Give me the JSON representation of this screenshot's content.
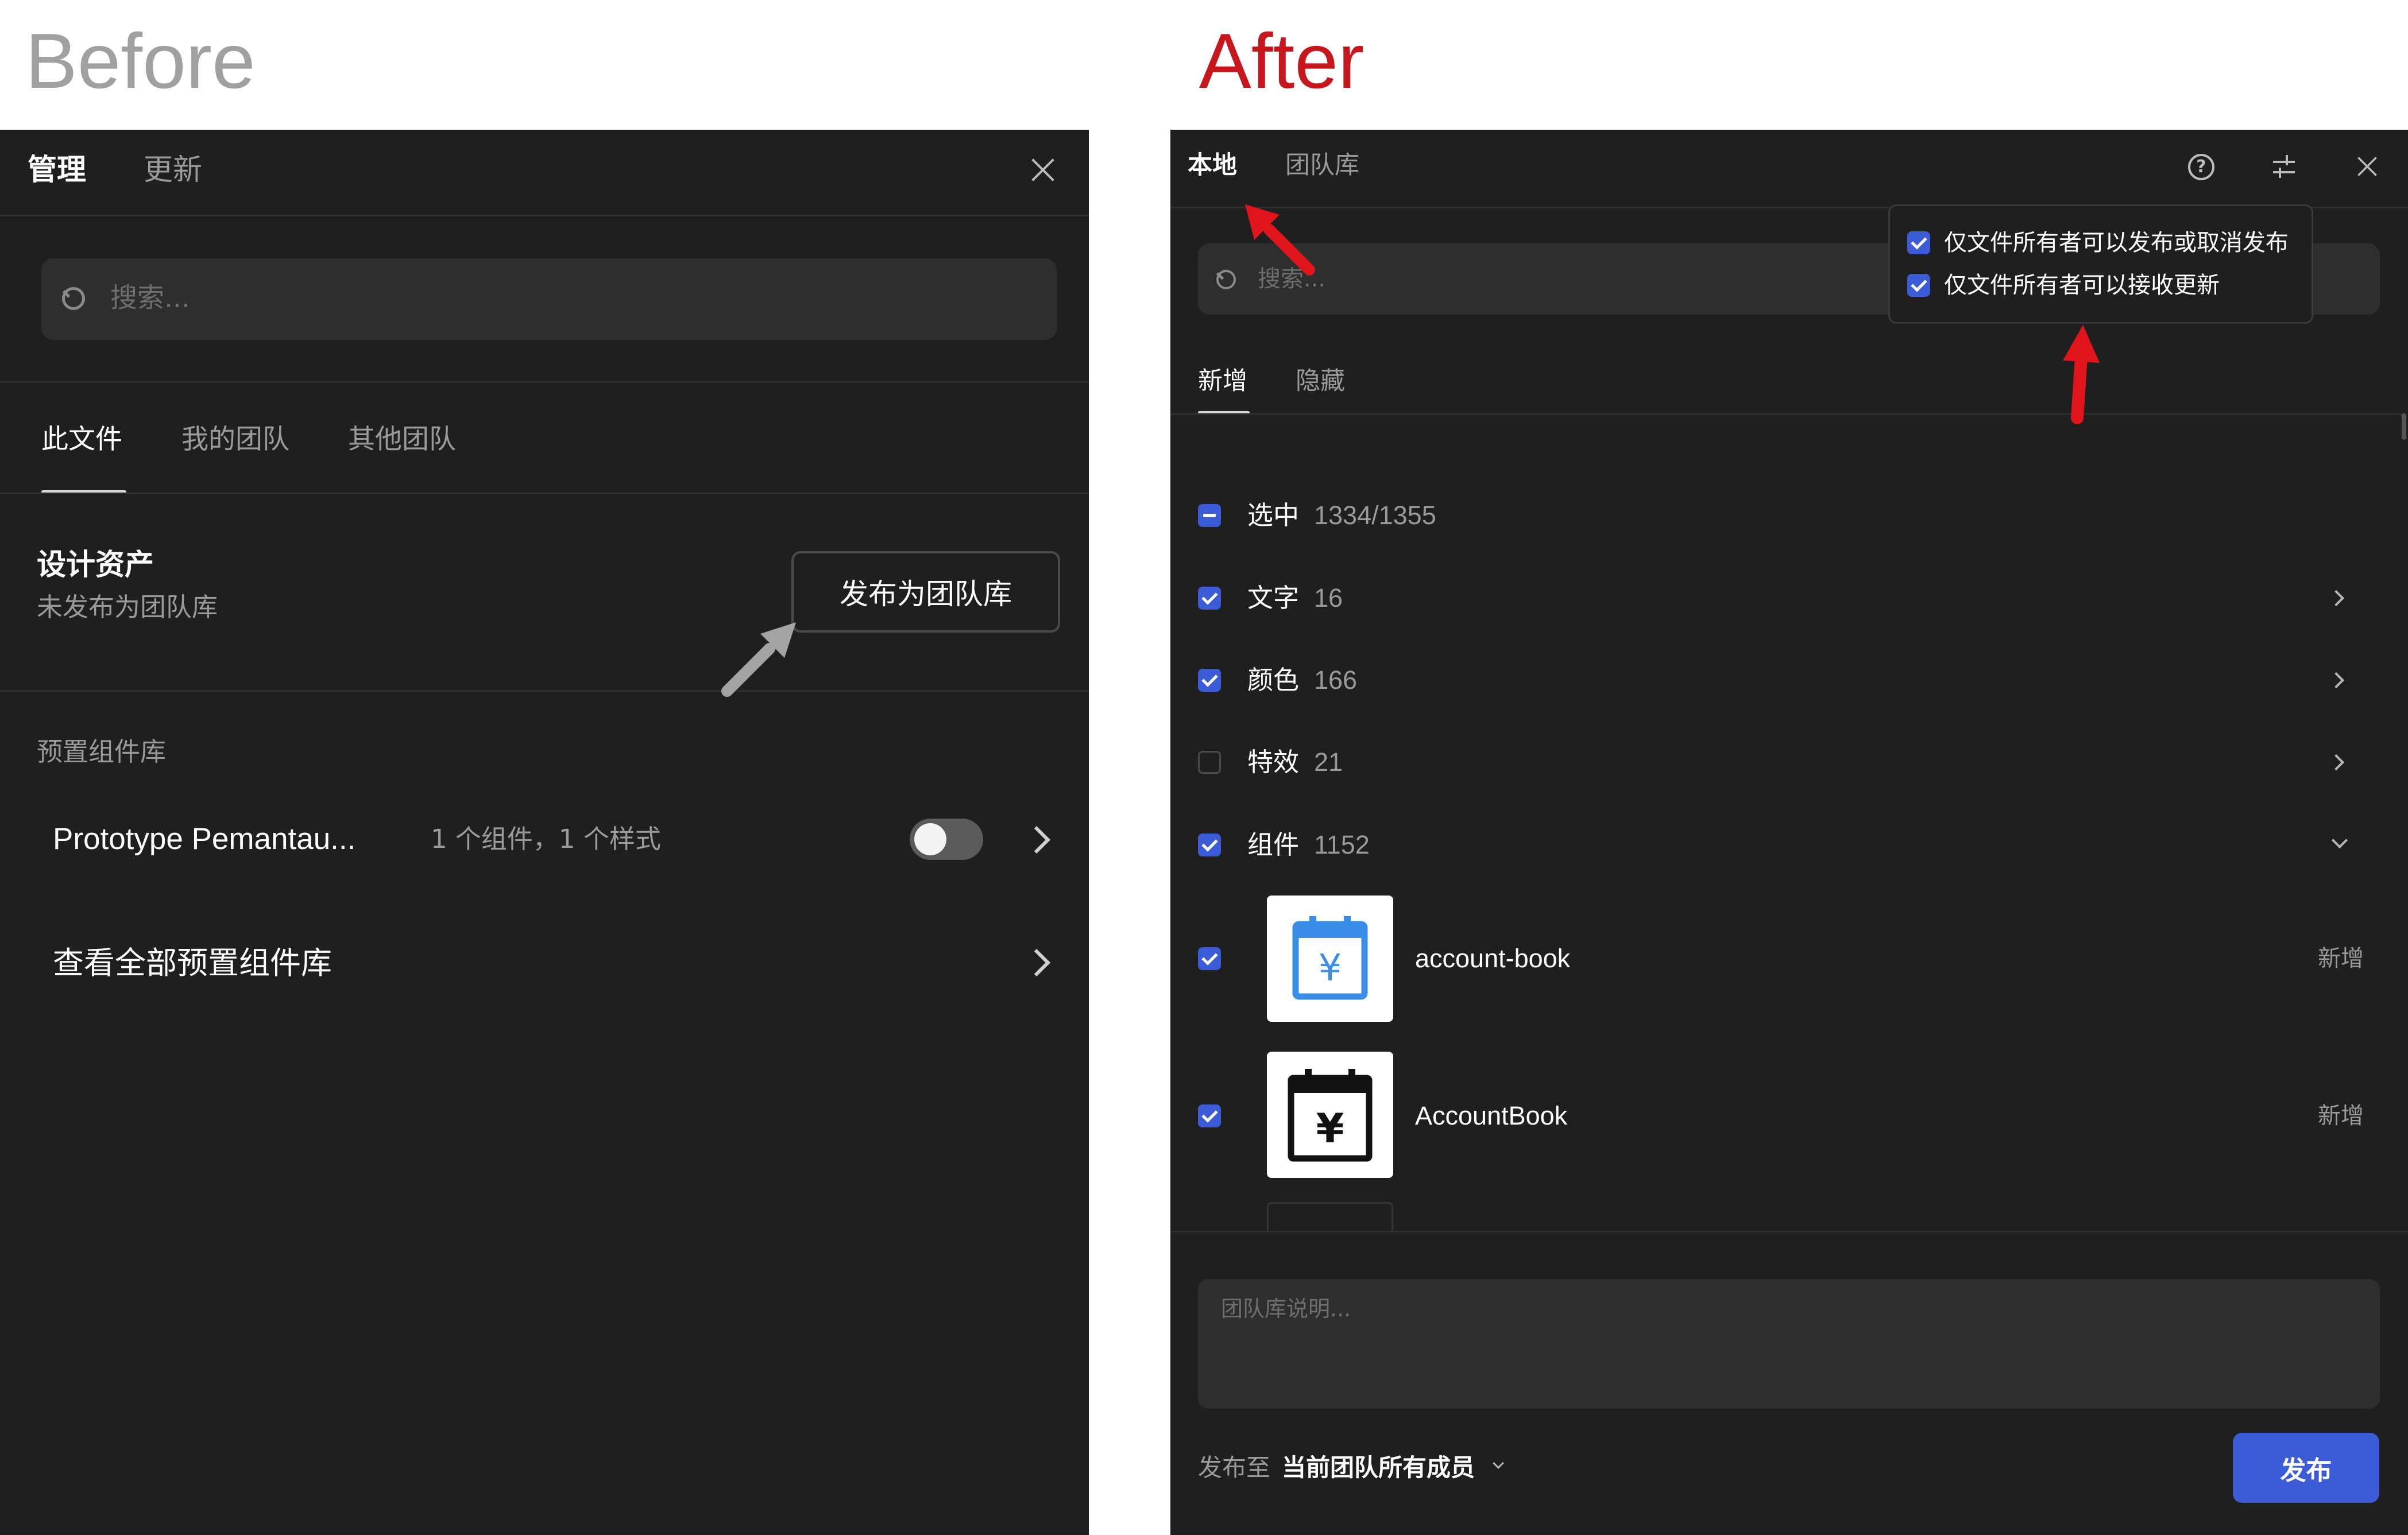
{
  "labels": {
    "before": "Before",
    "after": "After"
  },
  "before": {
    "tabs": [
      "管理",
      "更新"
    ],
    "search_placeholder": "搜索...",
    "sub_tabs": [
      "此文件",
      "我的团队",
      "其他团队"
    ],
    "asset": {
      "title": "设计资产",
      "subtitle": "未发布为团队库",
      "button": "发布为团队库"
    },
    "section_label": "预置组件库",
    "preset": {
      "name": "Prototype Pemantau...",
      "meta": "1 个组件，1 个样式",
      "enabled": false
    },
    "view_all": "查看全部预置组件库"
  },
  "after": {
    "tabs": [
      "本地",
      "团队库"
    ],
    "search_placeholder": "搜索...",
    "popover": {
      "options": [
        "仅文件所有者可以发布或取消发布",
        "仅文件所有者可以接收更新"
      ]
    },
    "sub_tabs": [
      "新增",
      "隐藏"
    ],
    "rows": [
      {
        "label": "选中",
        "count": "1334/1355"
      },
      {
        "label": "文字",
        "count": "16"
      },
      {
        "label": "颜色",
        "count": "166"
      },
      {
        "label": "特效",
        "count": "21"
      },
      {
        "label": "组件",
        "count": "1152"
      }
    ],
    "components": [
      {
        "name": "account-book",
        "status": "新增"
      },
      {
        "name": "AccountBook",
        "status": "新增"
      }
    ],
    "description_placeholder": "团队库说明...",
    "publish_to_label": "发布至",
    "publish_to_value": "当前团队所有成员",
    "publish_button": "发布"
  },
  "colors": {
    "panel_bg": "#1f1f1f",
    "accent": "#3c5bd6",
    "annotation_red": "#e0141b",
    "annotation_gray": "#a3a3a3",
    "before_label": "#a0a0a0",
    "after_label": "#c8161d"
  }
}
